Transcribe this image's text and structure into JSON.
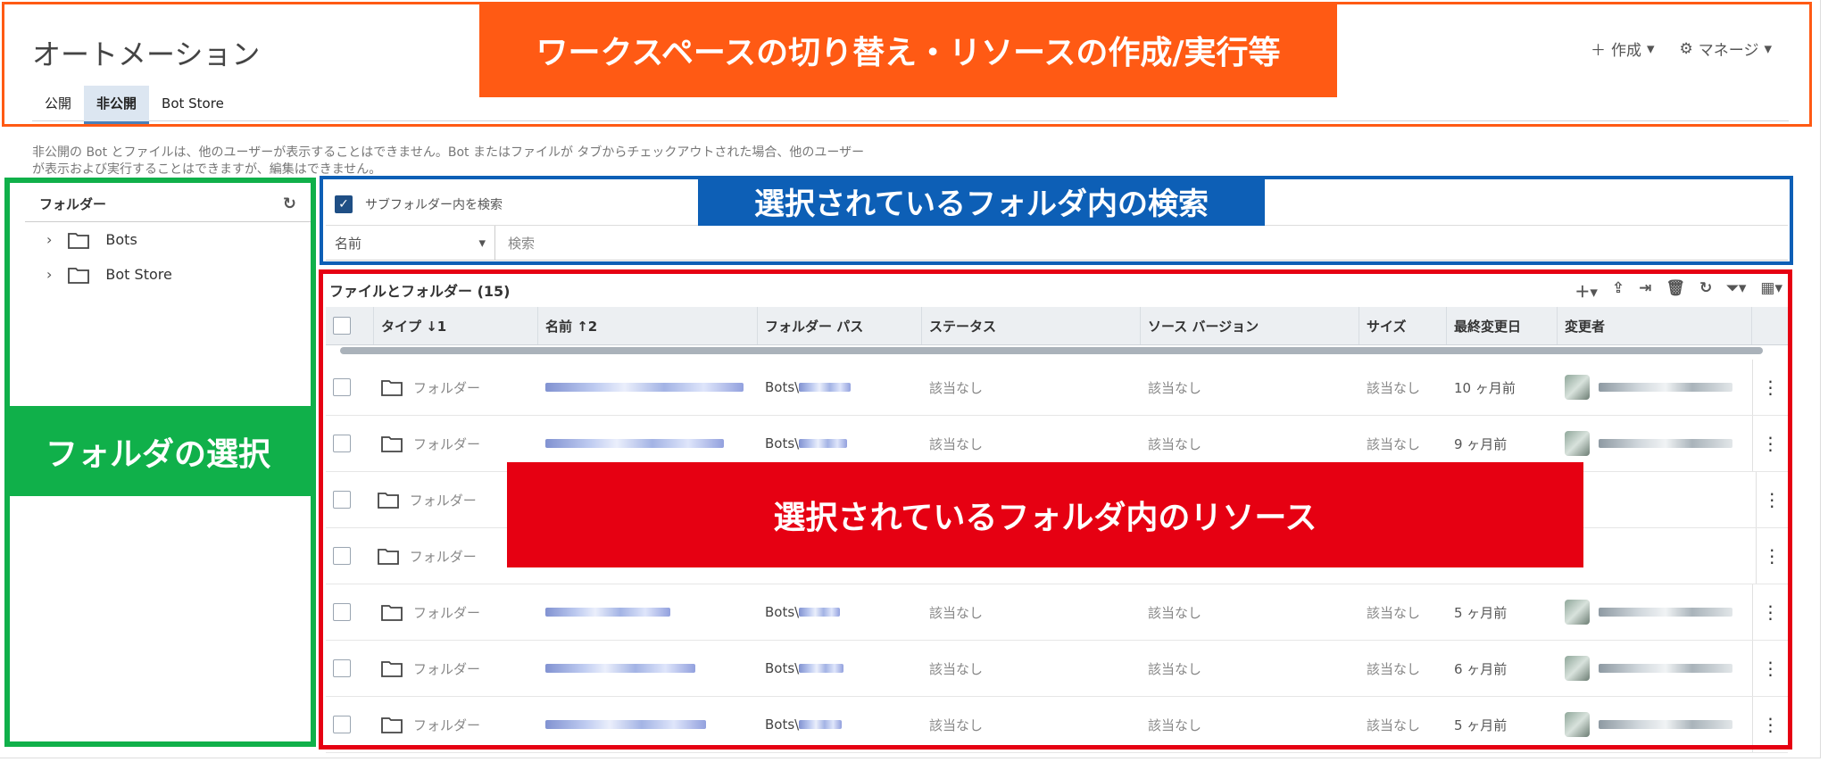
{
  "header": {
    "title": "オートメーション",
    "create_label": "作成",
    "manage_label": "マネージ"
  },
  "tabs": [
    {
      "label": "公開",
      "active": false
    },
    {
      "label": "非公開",
      "active": true
    },
    {
      "label": "Bot Store",
      "active": false
    }
  ],
  "info_text_1": "非公開の Bot とファイルは、他のユーザーが表示することはできません。Bot またはファイルが タブからチェックアウトされた場合、他のユーザー",
  "info_text_2": "が表示および実行することはできますが、編集はできません。",
  "folders": {
    "title": "フォルダー",
    "items": [
      {
        "label": "Bots"
      },
      {
        "label": "Bot Store"
      }
    ]
  },
  "search": {
    "subfolder_label": "サブフォルダー内を検索",
    "subfolder_checked": true,
    "field_selected": "名前",
    "placeholder": "検索"
  },
  "grid": {
    "title": "ファイルとフォルダー (15)",
    "columns": [
      "タイプ ↓1",
      "名前 ↑2",
      "フォルダー パス",
      "ステータス",
      "ソース バージョン",
      "サイズ",
      "最終変更日",
      "変更者"
    ],
    "rows": [
      {
        "type": "フォルダー",
        "path": "Bots\\",
        "status": "該当なし",
        "source": "該当なし",
        "size": "該当なし",
        "modified": "10 ヶ月前"
      },
      {
        "type": "フォルダー",
        "path": "Bots\\",
        "status": "該当なし",
        "source": "該当なし",
        "size": "該当なし",
        "modified": "9 ヶ月前"
      },
      {
        "type": "フォルダー",
        "path": "",
        "status": "",
        "source": "",
        "size": "",
        "modified": ""
      },
      {
        "type": "フォルダー",
        "path": "",
        "status": "",
        "source": "",
        "size": "",
        "modified": ""
      },
      {
        "type": "フォルダー",
        "path": "Bots\\",
        "status": "該当なし",
        "source": "該当なし",
        "size": "該当なし",
        "modified": "5 ヶ月前"
      },
      {
        "type": "フォルダー",
        "path": "Bots\\",
        "status": "該当なし",
        "source": "該当なし",
        "size": "該当なし",
        "modified": "6 ヶ月前"
      },
      {
        "type": "フォルダー",
        "path": "Bots\\",
        "status": "該当なし",
        "source": "該当なし",
        "size": "該当なし",
        "modified": "5 ヶ月前"
      }
    ]
  },
  "annotations": {
    "header": "ワークスペースの切り替え・リソースの作成/実行等",
    "folder_select": "フォルダの選択",
    "search": "選択されているフォルダ内の検索",
    "resources": "選択されているフォルダ内のリソース"
  },
  "colors": {
    "orange": "#ff5a14",
    "green": "#10b04a",
    "blue": "#0d5fb6",
    "red": "#e60012",
    "accent": "#1f4f85"
  }
}
